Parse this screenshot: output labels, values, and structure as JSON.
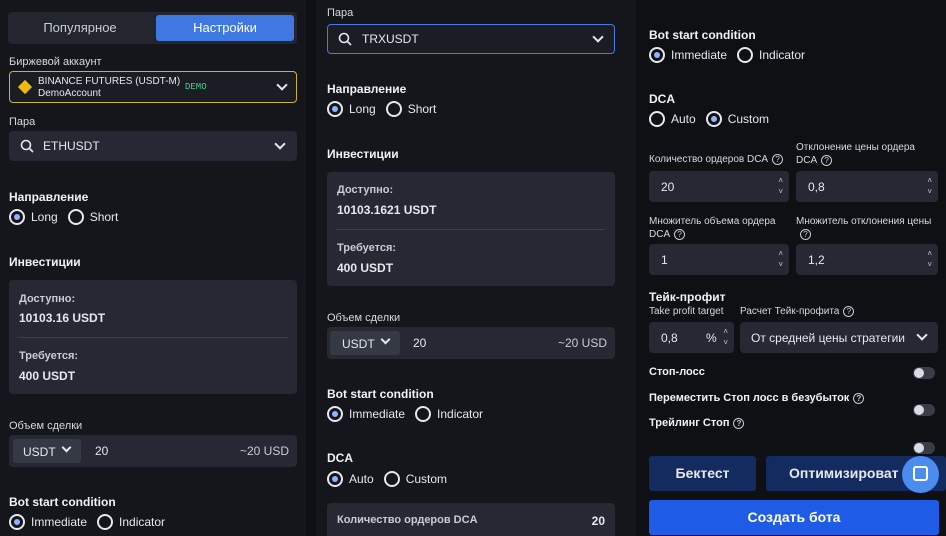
{
  "left": {
    "tabs": [
      "Популярное",
      "Настройки"
    ],
    "exchange_label": "Биржевой аккаунт",
    "exchange_name": "BINANCE FUTURES (USDT-M)",
    "exchange_account": "DemoAccount",
    "demo_badge": "DEMO",
    "pair_label": "Пара",
    "pair_value": "ETHUSDT",
    "direction_label": "Направление",
    "direction_long": "Long",
    "direction_short": "Short",
    "invest_label": "Инвестиции",
    "available_label": "Доступно:",
    "available_value": "10103.16 USDT",
    "required_label": "Требуется:",
    "required_value": "400 USDT",
    "volume_label": "Объем сделки",
    "volume_currency": "USDT",
    "volume_value": "20",
    "volume_approx": "~20 USD",
    "start_label": "Bot start condition",
    "start_immediate": "Immediate",
    "start_indicator": "Indicator"
  },
  "mid": {
    "pair_label": "Пара",
    "pair_value": "TRXUSDT",
    "direction_label": "Направление",
    "direction_long": "Long",
    "direction_short": "Short",
    "invest_label": "Инвестиции",
    "available_label": "Доступно:",
    "available_value": "10103.1621 USDT",
    "required_label": "Требуется:",
    "required_value": "400 USDT",
    "volume_label": "Объем сделки",
    "volume_currency": "USDT",
    "volume_value": "20",
    "volume_approx": "~20 USD",
    "start_label": "Bot start condition",
    "start_immediate": "Immediate",
    "start_indicator": "Indicator",
    "dca_label": "DCA",
    "dca_auto": "Auto",
    "dca_custom": "Custom",
    "dca_orders_label": "Количество ордеров DCA",
    "dca_orders_value": "20"
  },
  "right": {
    "start_label": "Bot start condition",
    "start_immediate": "Immediate",
    "start_indicator": "Indicator",
    "dca_label": "DCA",
    "dca_auto": "Auto",
    "dca_custom": "Custom",
    "orders_label": "Количество ордеров DCA",
    "orders_value": "20",
    "deviation_label": "Отклонение цены ордера DCA",
    "deviation_value": "0,8",
    "vol_mult_label": "Множитель объема ордера DCA",
    "vol_mult_value": "1",
    "dev_mult_label": "Множитель отклонения цены",
    "dev_mult_value": "1,2",
    "tp_label": "Тейк-профит",
    "tp_target_label": "Take profit target",
    "tp_calc_label": "Расчет Тейк-профита",
    "tp_value": "0,8",
    "tp_unit": "%",
    "tp_calc_value": "От средней цены стратегии",
    "stoploss_label": "Стоп-лосс",
    "breakeven_label": "Переместить Стоп лосс в безубыток",
    "trailing_label": "Трейлинг Стоп",
    "backtest_button": "Бектест",
    "optimize_button": "Оптимизироват",
    "create_button": "Создать бота",
    "qm": "?",
    "up": "˄",
    "down": "˅"
  }
}
